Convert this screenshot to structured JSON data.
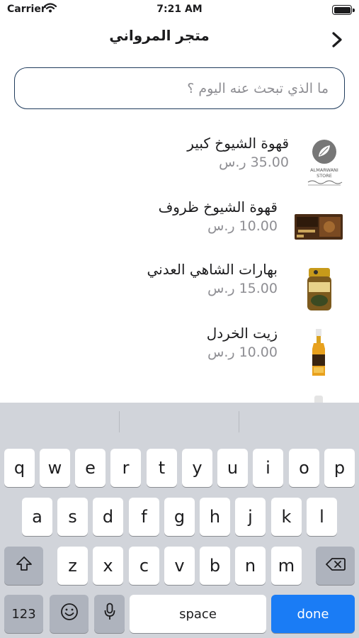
{
  "status_bar": {
    "carrier": "Carrier",
    "time": "7:21 AM",
    "battery_level": 1.0
  },
  "nav": {
    "title": "متجر المرواني",
    "back_icon": "chevron-icon"
  },
  "search": {
    "placeholder": "ما الذي تبحث عنه اليوم ؟",
    "value": ""
  },
  "products": [
    {
      "name": "قهوة الشيوخ كبير",
      "price": "35.00 ر.س",
      "thumb": "almarwani-store-logo"
    },
    {
      "name": "قهوة الشيوخ ظروف",
      "price": "10.00 ر.س",
      "thumb": "coffee-box"
    },
    {
      "name": "بهارات الشاهي العدني",
      "price": "15.00 ر.س",
      "thumb": "spice-jar"
    },
    {
      "name": "زيت الخردل",
      "price": "10.00 ر.س",
      "thumb": "oil-bottle"
    }
  ],
  "logo_text": {
    "line1": "ALMARWANI",
    "line2": "STORE"
  },
  "keyboard": {
    "row1": [
      "q",
      "w",
      "e",
      "r",
      "t",
      "y",
      "u",
      "i",
      "o",
      "p"
    ],
    "row2": [
      "a",
      "s",
      "d",
      "f",
      "g",
      "h",
      "j",
      "k",
      "l"
    ],
    "row3": [
      "z",
      "x",
      "c",
      "v",
      "b",
      "n",
      "m"
    ],
    "numbers_label": "123",
    "space_label": "space",
    "done_label": "done"
  },
  "colors": {
    "accent": "#1a7cf5",
    "search_border": "#1f3b5c",
    "price": "#8e8e93"
  }
}
